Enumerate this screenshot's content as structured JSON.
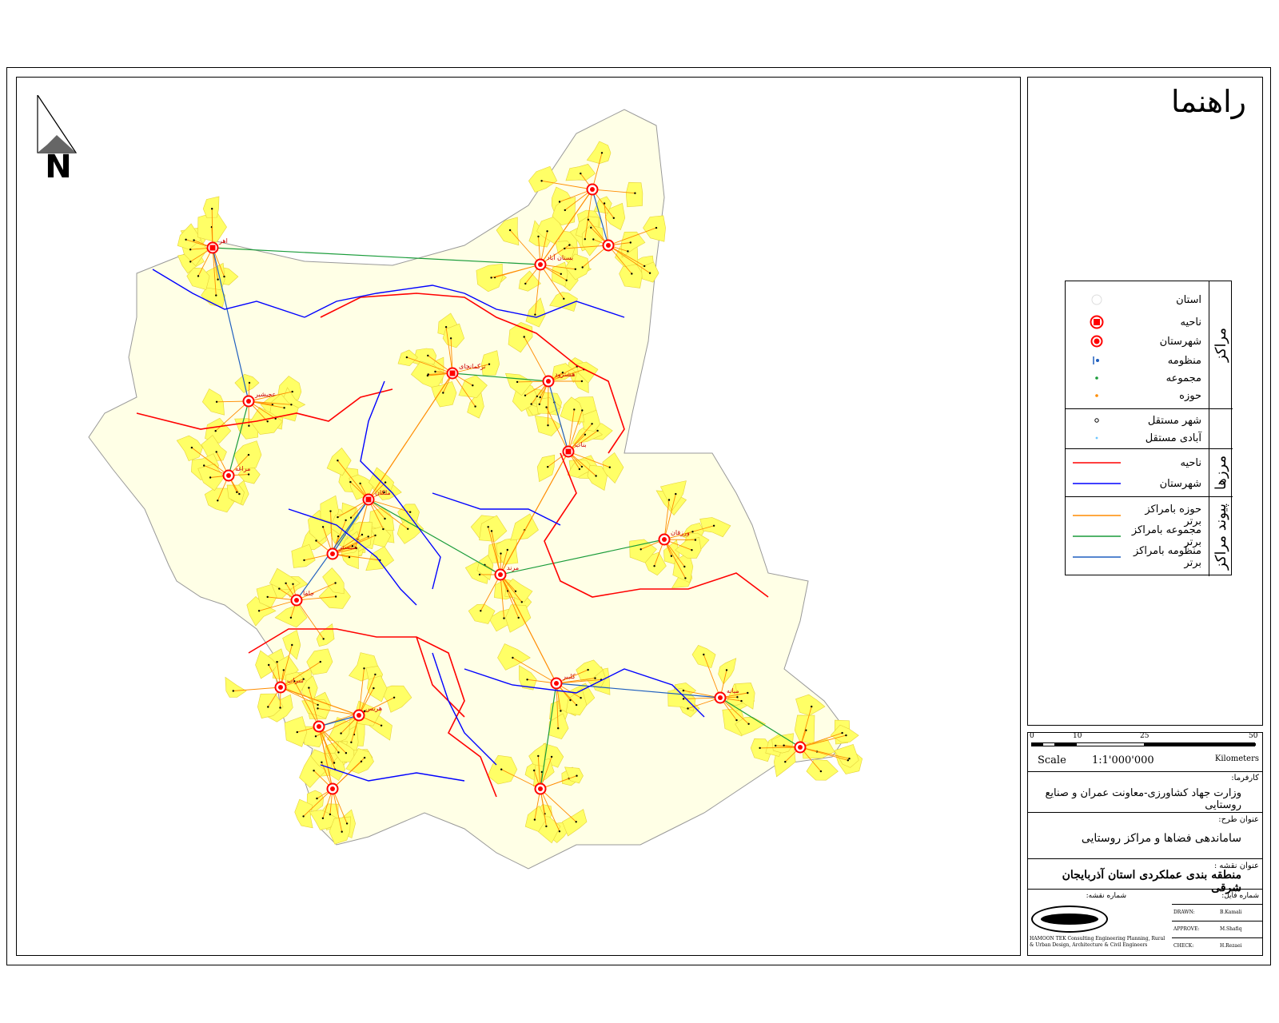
{
  "map": {
    "north_label": "N",
    "colors": {
      "region_fill": "#ffff66",
      "province_boundary": "#ff0000",
      "county_boundary": "#0000ff",
      "link_orange": "#ff8c00",
      "link_green": "#1a9c3a",
      "link_blue": "#1f5fbf",
      "center_red": "#ff0000"
    },
    "major_centers": [
      "اهر",
      "بستان آباد",
      "ترکمانچای",
      "هشترود",
      "عجبشیر",
      "مراغه",
      "بناب",
      "ملکان",
      "شبستر",
      "مرند",
      "جلفا",
      "ورزقان",
      "کلیبر",
      "میانه",
      "سراب",
      "هریس"
    ]
  },
  "legend": {
    "title": "راهنما",
    "centers_section": "مراکز",
    "borders_section": "مرزها",
    "links_section": "پیوند مراکز",
    "items": {
      "province": "استان",
      "district": "ناحیه",
      "county": "شهرستان",
      "system": "منظومه",
      "group": "مجموعه",
      "zone": "حوزه",
      "independent_city": "شهر مستقل",
      "independent_village": "آبادی مستقل",
      "border_district": "ناحیه",
      "border_county": "شهرستان",
      "link_zone": "حوزه بامراکز برتر",
      "link_group": "مجموعه بامراکز برتر",
      "link_system": "منظومه بامراکز برتر"
    }
  },
  "scale": {
    "ticks": [
      "0",
      "10",
      "25",
      "50"
    ],
    "label": "Scale",
    "ratio": "1:1'000'000",
    "unit": "Kilometers"
  },
  "info": {
    "client_caption": "کارفرما:",
    "client": "وزارت جهاد کشاورزی-معاونت عمران و صنایع روستایی",
    "project_caption": "عنوان طرح:",
    "project": "ساماندهی فضاها و مراکز روستایی",
    "map_caption": "عنوان نقشه :",
    "map_title": "منطقه بندی عملکردی استان آذربایجان شرقی",
    "file_caption": "شماره فایل:",
    "map_no_caption": "شماره نقشه:",
    "company": "HAMOON TEK Consulting Engineering Planning, Rural & Urban Design, Architecture & Civil Engineers",
    "signoff": [
      {
        "role": "DRAWN:",
        "name": "B.Kamali"
      },
      {
        "role": "APPROVE:",
        "name": "M.Shafiq"
      },
      {
        "role": "CHECK:",
        "name": "H.Rezaei"
      }
    ]
  }
}
